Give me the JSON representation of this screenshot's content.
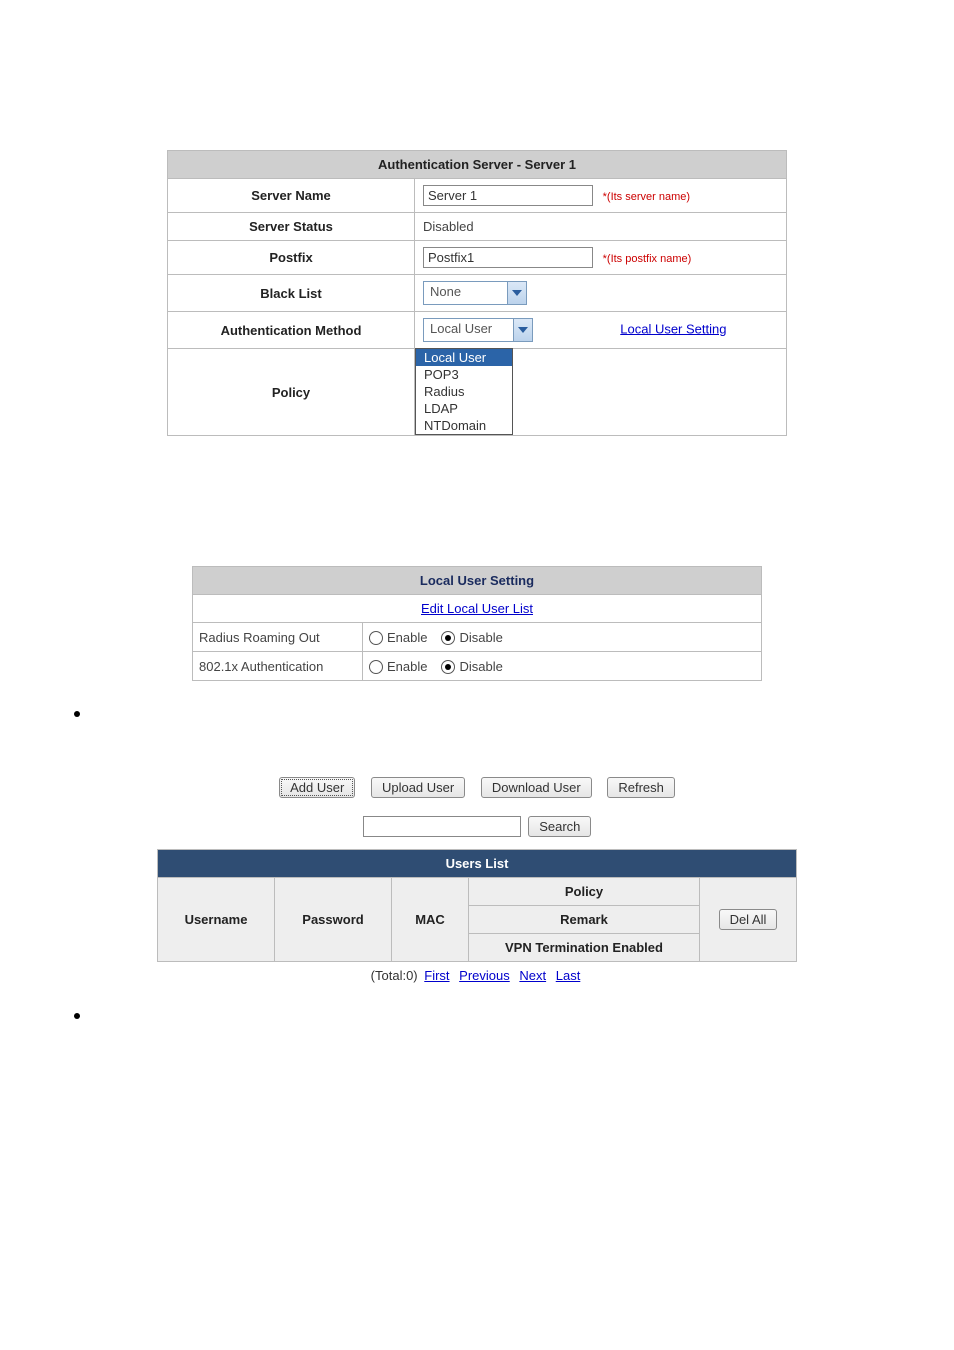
{
  "auth": {
    "title": "Authentication Server - Server 1",
    "server_name_label": "Server Name",
    "server_name_value": "Server 1",
    "server_name_hint": "*(Its server name)",
    "server_status_label": "Server Status",
    "server_status_value": "Disabled",
    "postfix_label": "Postfix",
    "postfix_value": "Postfix1",
    "postfix_hint": "*(Its postfix name)",
    "blacklist_label": "Black List",
    "blacklist_value": "None",
    "method_label": "Authentication Method",
    "method_value": "Local User",
    "method_link": "Local User Setting",
    "policy_label": "Policy",
    "method_options": [
      "Local User",
      "POP3",
      "Radius",
      "LDAP",
      "NTDomain"
    ],
    "method_selected_index": 0
  },
  "local": {
    "title": "Local User Setting",
    "edit_link": "Edit Local User List",
    "rows": [
      {
        "label": "Radius Roaming Out",
        "enable": "Enable",
        "disable": "Disable",
        "checked": "disable"
      },
      {
        "label": "802.1x Authentication",
        "enable": "Enable",
        "disable": "Disable",
        "checked": "disable"
      }
    ]
  },
  "users": {
    "buttons": {
      "add": "Add User",
      "upload": "Upload User",
      "download": "Download User",
      "refresh": "Refresh",
      "search": "Search",
      "del_all": "Del All"
    },
    "search_value": "",
    "title": "Users List",
    "cols": {
      "username": "Username",
      "password": "Password",
      "mac": "MAC",
      "policy": "Policy",
      "remark": "Remark",
      "vpn": "VPN Termination Enabled"
    },
    "pager": {
      "total_label": "(Total:0)",
      "first": "First",
      "previous": "Previous",
      "next": "Next",
      "last": "Last"
    }
  }
}
